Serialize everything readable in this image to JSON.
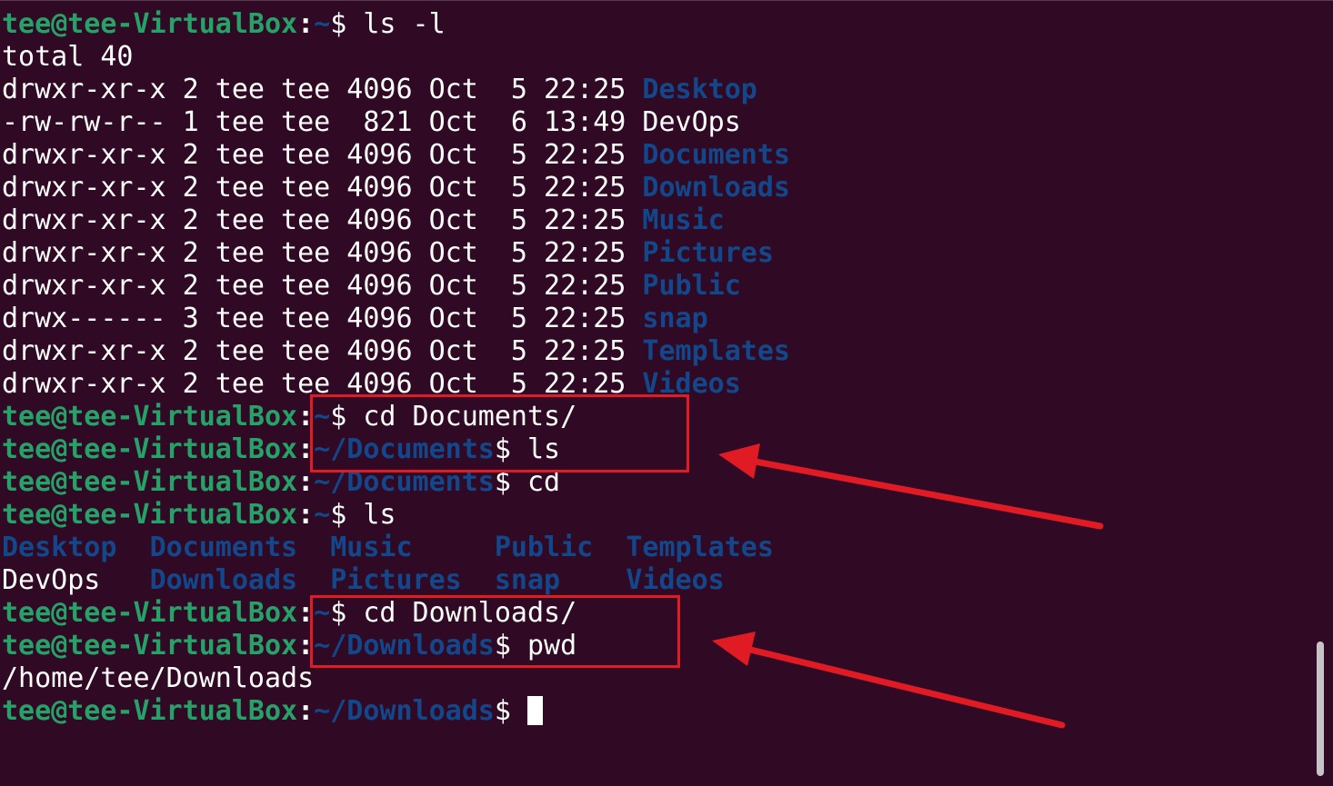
{
  "colors": {
    "background": "#300a24",
    "prompt_user": "#26a269",
    "directory": "#12488b",
    "highlight": "#e01b24",
    "text": "#ffffff"
  },
  "prompt": {
    "user_host": "tee@tee-VirtualBox",
    "separator": ":",
    "dollar": "$ "
  },
  "lines": [
    {
      "path": "~",
      "cmd": "ls -l"
    },
    {
      "text": "total 40"
    },
    {
      "listing": "drwxr-xr-x 2 tee tee 4096 Oct  5 22:25 ",
      "name": "Desktop",
      "is_dir": true
    },
    {
      "listing": "-rw-rw-r-- 1 tee tee  821 Oct  6 13:49 ",
      "name": "DevOps",
      "is_dir": false
    },
    {
      "listing": "drwxr-xr-x 2 tee tee 4096 Oct  5 22:25 ",
      "name": "Documents",
      "is_dir": true
    },
    {
      "listing": "drwxr-xr-x 2 tee tee 4096 Oct  5 22:25 ",
      "name": "Downloads",
      "is_dir": true
    },
    {
      "listing": "drwxr-xr-x 2 tee tee 4096 Oct  5 22:25 ",
      "name": "Music",
      "is_dir": true
    },
    {
      "listing": "drwxr-xr-x 2 tee tee 4096 Oct  5 22:25 ",
      "name": "Pictures",
      "is_dir": true
    },
    {
      "listing": "drwxr-xr-x 2 tee tee 4096 Oct  5 22:25 ",
      "name": "Public",
      "is_dir": true
    },
    {
      "listing": "drwx------ 3 tee tee 4096 Oct  5 22:25 ",
      "name": "snap",
      "is_dir": true
    },
    {
      "listing": "drwxr-xr-x 2 tee tee 4096 Oct  5 22:25 ",
      "name": "Templates",
      "is_dir": true
    },
    {
      "listing": "drwxr-xr-x 2 tee tee 4096 Oct  5 22:25 ",
      "name": "Videos",
      "is_dir": true
    },
    {
      "path": "~",
      "cmd": "cd Documents/"
    },
    {
      "path": "~/Documents",
      "cmd": "ls"
    },
    {
      "path": "~/Documents",
      "cmd": "cd"
    },
    {
      "path": "~",
      "cmd": "ls"
    },
    {
      "grid": [
        {
          "name": "Desktop  ",
          "is_dir": true
        },
        {
          "name": "Documents  ",
          "is_dir": true
        },
        {
          "name": "Music     ",
          "is_dir": true
        },
        {
          "name": "Public  ",
          "is_dir": true
        },
        {
          "name": "Templates",
          "is_dir": true
        }
      ]
    },
    {
      "grid": [
        {
          "name": "DevOps   ",
          "is_dir": false
        },
        {
          "name": "Downloads  ",
          "is_dir": true
        },
        {
          "name": "Pictures  ",
          "is_dir": true
        },
        {
          "name": "snap    ",
          "is_dir": true
        },
        {
          "name": "Videos",
          "is_dir": true
        }
      ]
    },
    {
      "path": "~",
      "cmd": "cd Downloads/"
    },
    {
      "path": "~/Downloads",
      "cmd": "pwd"
    },
    {
      "text": "/home/tee/Downloads"
    },
    {
      "path": "~/Downloads",
      "cmd": "",
      "cursor": true
    }
  ]
}
